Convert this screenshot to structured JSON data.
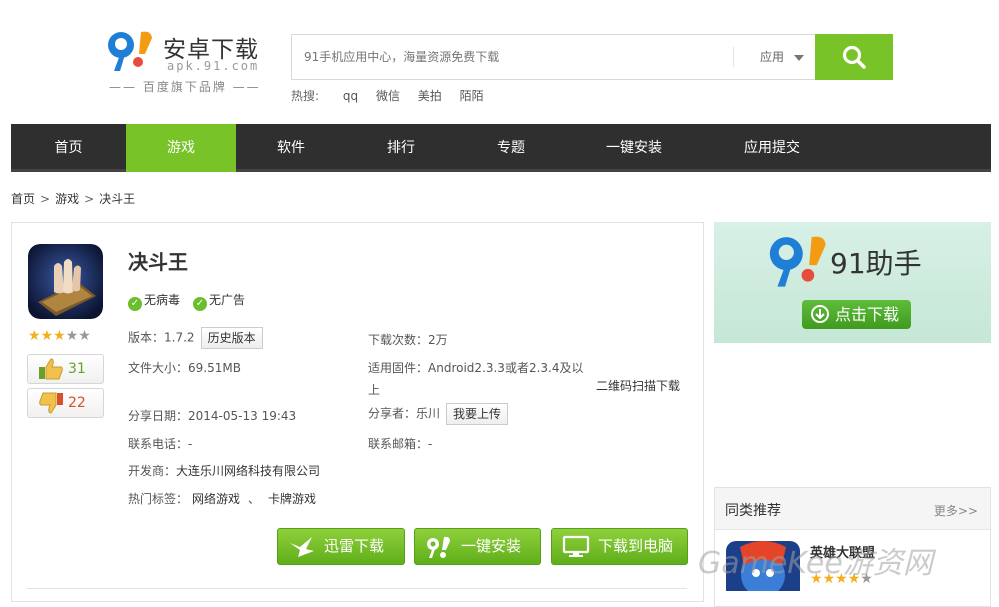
{
  "header": {
    "logo_title": "安卓下载",
    "logo_domain": "apk.91.com",
    "logo_tagline": "—— 百度旗下品牌 ——",
    "search_placeholder": "91手机应用中心，海量资源免费下载",
    "search_category": "应用",
    "hot_label": "热搜:",
    "hot_terms": [
      "qq",
      "微信",
      "美拍",
      "陌陌"
    ],
    "accent_color": "#78c327"
  },
  "nav": {
    "items": [
      "首页",
      "游戏",
      "软件",
      "排行",
      "专题",
      "一键安装",
      "应用提交"
    ],
    "active": "游戏"
  },
  "breadcrumb": [
    "首页",
    "游戏",
    "决斗王"
  ],
  "app": {
    "title": "决斗王",
    "badges": [
      "无病毒",
      "无广告"
    ],
    "rating_stars": 3,
    "rating_max": 5,
    "likes": "31",
    "dislikes": "22",
    "version_label": "版本：",
    "version": "1.7.2",
    "history_btn": "历史版本",
    "downloads_label": "下载次数：",
    "downloads": "2万",
    "size_label": "文件大小：",
    "size": "69.51MB",
    "firmware_label": "适用固件：",
    "firmware_line1": "Android2.3.3或者2.3.4及以",
    "firmware_line2": "上",
    "qr_label": "二维码扫描下载",
    "share_date_label": "分享日期：",
    "share_date": "2014-05-13 19:43",
    "sharer_label": "分享者：",
    "sharer": "乐川",
    "upload_btn": "我要上传",
    "phone_label": "联系电话：",
    "phone": "-",
    "email_label": "联系邮箱：",
    "email": "-",
    "developer_label": "开发商：",
    "developer": "大连乐川网络科技有限公司",
    "tags_label": "热门标签：",
    "tags": [
      "网络游戏",
      "卡牌游戏"
    ],
    "tag_sep": "、",
    "download_buttons": [
      "迅雷下载",
      "一键安装",
      "下载到电脑"
    ]
  },
  "banner": {
    "title": "91助手",
    "button": "点击下载"
  },
  "recommend": {
    "title": "同类推荐",
    "more": "更多>>",
    "app_name": "英雄大联盟",
    "app_stars": 4
  },
  "watermark": "GameKee游资网"
}
